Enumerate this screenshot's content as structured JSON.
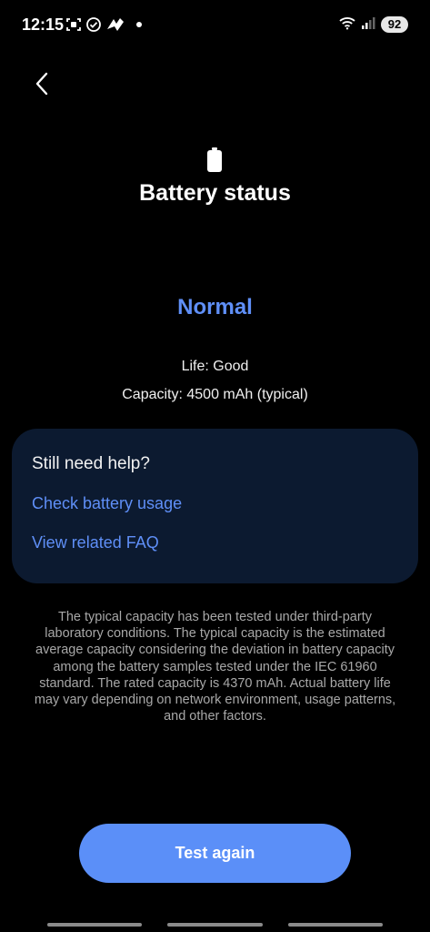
{
  "status_bar": {
    "time": "12:15",
    "battery_level": "92",
    "icons": [
      "screenshot-icon",
      "check-circle-icon",
      "gesture-app-icon",
      "notification-dot-icon",
      "wifi-icon",
      "signal-icon"
    ]
  },
  "header": {
    "back_icon": "chevron-left-icon",
    "battery_icon": "battery-icon",
    "title": "Battery status"
  },
  "battery": {
    "status": "Normal",
    "life": "Life: Good",
    "capacity": "Capacity: 4500 mAh (typical)"
  },
  "help_card": {
    "title": "Still need help?",
    "links": [
      {
        "label": "Check battery usage"
      },
      {
        "label": "View related FAQ"
      }
    ]
  },
  "disclaimer": "The typical capacity has been tested under third-party laboratory conditions. The typical capacity is the estimated average capacity considering the deviation in battery capacity among the battery samples tested under the IEC 61960 standard. The rated capacity is 4370 mAh. Actual battery life may vary depending on network environment, usage patterns, and other factors.",
  "actions": {
    "test_again": "Test again"
  },
  "colors": {
    "accent": "#5f8ff7",
    "card_bg": "#0c1a30",
    "button_bg": "#5b8ff8",
    "background": "#000000"
  }
}
